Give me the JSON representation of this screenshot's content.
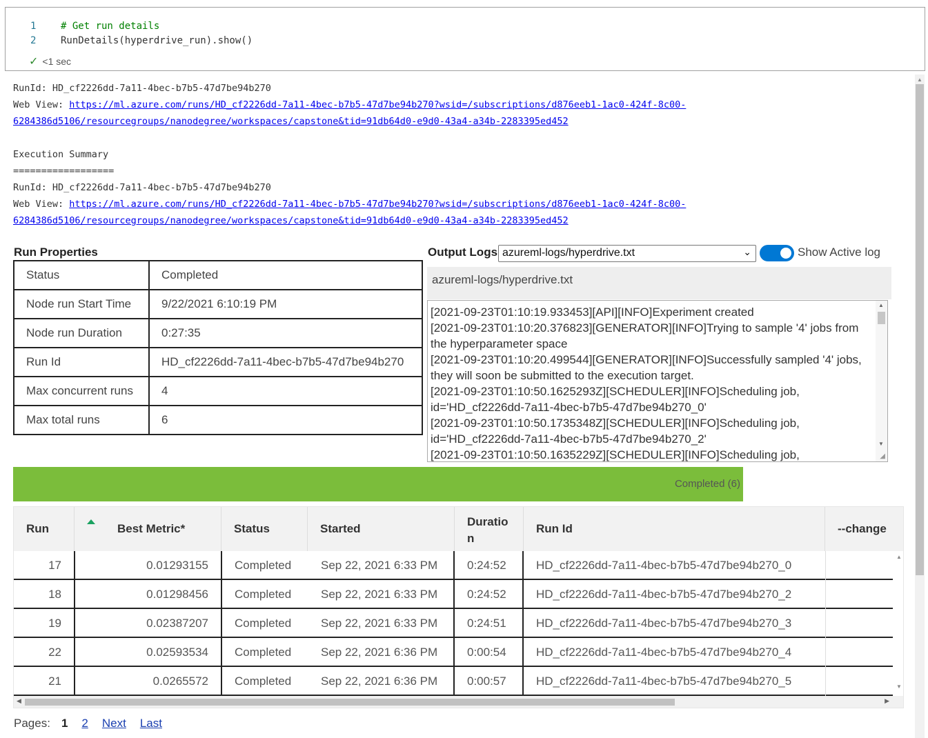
{
  "code_cell": {
    "lines": [
      {
        "num": "1",
        "text": "# Get run details"
      },
      {
        "num": "2",
        "text": "RunDetails(hyperdrive_run).show()"
      }
    ],
    "exec_time": "<1 sec"
  },
  "output": {
    "runid_line": "RunId: HD_cf2226dd-7a11-4bec-b7b5-47d7be94b270",
    "webview_label": "Web View: ",
    "webview_url_line1": "https://ml.azure.com/runs/HD_cf2226dd-7a11-4bec-b7b5-47d7be94b270?wsid=/subscriptions/d876eeb1-1ac0-424f-8c00-",
    "webview_url_line2": "6284386d5106/resourcegroups/nanodegree/workspaces/capstone&tid=91db64d0-e9d0-43a4-a34b-2283395ed452",
    "summary_title": "Execution Summary",
    "summary_rule": "=================="
  },
  "run_properties": {
    "title": "Run Properties",
    "rows": [
      {
        "key": "Status",
        "value": "Completed"
      },
      {
        "key": "Node run Start Time",
        "value": "9/22/2021 6:10:19 PM"
      },
      {
        "key": "Node run Duration",
        "value": "0:27:35"
      },
      {
        "key": "Run Id",
        "value": "HD_cf2226dd-7a11-4bec-b7b5-47d7be94b270"
      },
      {
        "key": "Max concurrent runs",
        "value": "4"
      },
      {
        "key": "Max total runs",
        "value": "6"
      }
    ]
  },
  "output_logs": {
    "title": "Output Logs",
    "selected_log": "azureml-logs/hyperdrive.txt",
    "toggle_label": "Show Active log",
    "toggle_on": true,
    "header": "azureml-logs/hyperdrive.txt",
    "lines": [
      "[2021-09-23T01:10:19.933453][API][INFO]Experiment created",
      "[2021-09-23T01:10:20.376823][GENERATOR][INFO]Trying to sample '4' jobs from the hyperparameter space",
      "[2021-09-23T01:10:20.499544][GENERATOR][INFO]Successfully sampled '4' jobs, they will soon be submitted to the execution target.",
      "[2021-09-23T01:10:50.1625293Z][SCHEDULER][INFO]Scheduling job, id='HD_cf2226dd-7a11-4bec-b7b5-47d7be94b270_0'",
      "[2021-09-23T01:10:50.1735348Z][SCHEDULER][INFO]Scheduling job, id='HD_cf2226dd-7a11-4bec-b7b5-47d7be94b270_2'",
      "[2021-09-23T01:10:50.1635229Z][SCHEDULER][INFO]Scheduling job,"
    ]
  },
  "progress": {
    "label": "Completed (6)",
    "fraction": 1.0,
    "color": "#7bbd3b"
  },
  "runs_table": {
    "columns": [
      "Run",
      "Best Metric*",
      "Status",
      "Started",
      "Duration",
      "Run Id",
      "--change"
    ],
    "header_wrapped_duration": [
      "Duratio",
      "n"
    ],
    "sorted_column": "Best Metric*",
    "sort_direction": "ascending",
    "rows": [
      {
        "run": "17",
        "metric": "0.01293155",
        "status": "Completed",
        "started": "Sep 22, 2021 6:33 PM",
        "duration": "0:24:52",
        "run_id": "HD_cf2226dd-7a11-4bec-b7b5-47d7be94b270_0"
      },
      {
        "run": "18",
        "metric": "0.01298456",
        "status": "Completed",
        "started": "Sep 22, 2021 6:33 PM",
        "duration": "0:24:52",
        "run_id": "HD_cf2226dd-7a11-4bec-b7b5-47d7be94b270_2"
      },
      {
        "run": "19",
        "metric": "0.02387207",
        "status": "Completed",
        "started": "Sep 22, 2021 6:33 PM",
        "duration": "0:24:51",
        "run_id": "HD_cf2226dd-7a11-4bec-b7b5-47d7be94b270_3"
      },
      {
        "run": "22",
        "metric": "0.02593534",
        "status": "Completed",
        "started": "Sep 22, 2021 6:36 PM",
        "duration": "0:00:54",
        "run_id": "HD_cf2226dd-7a11-4bec-b7b5-47d7be94b270_4"
      },
      {
        "run": "21",
        "metric": "0.0265572",
        "status": "Completed",
        "started": "Sep 22, 2021 6:36 PM",
        "duration": "0:00:57",
        "run_id": "HD_cf2226dd-7a11-4bec-b7b5-47d7be94b270_5"
      }
    ]
  },
  "pager": {
    "label": "Pages:",
    "current": "1",
    "pages": [
      "2"
    ],
    "next": "Next",
    "last": "Last"
  },
  "icons": {
    "check": "check-icon",
    "dropdown": "chevron-down-icon",
    "sort": "sort-ascending-icon"
  }
}
